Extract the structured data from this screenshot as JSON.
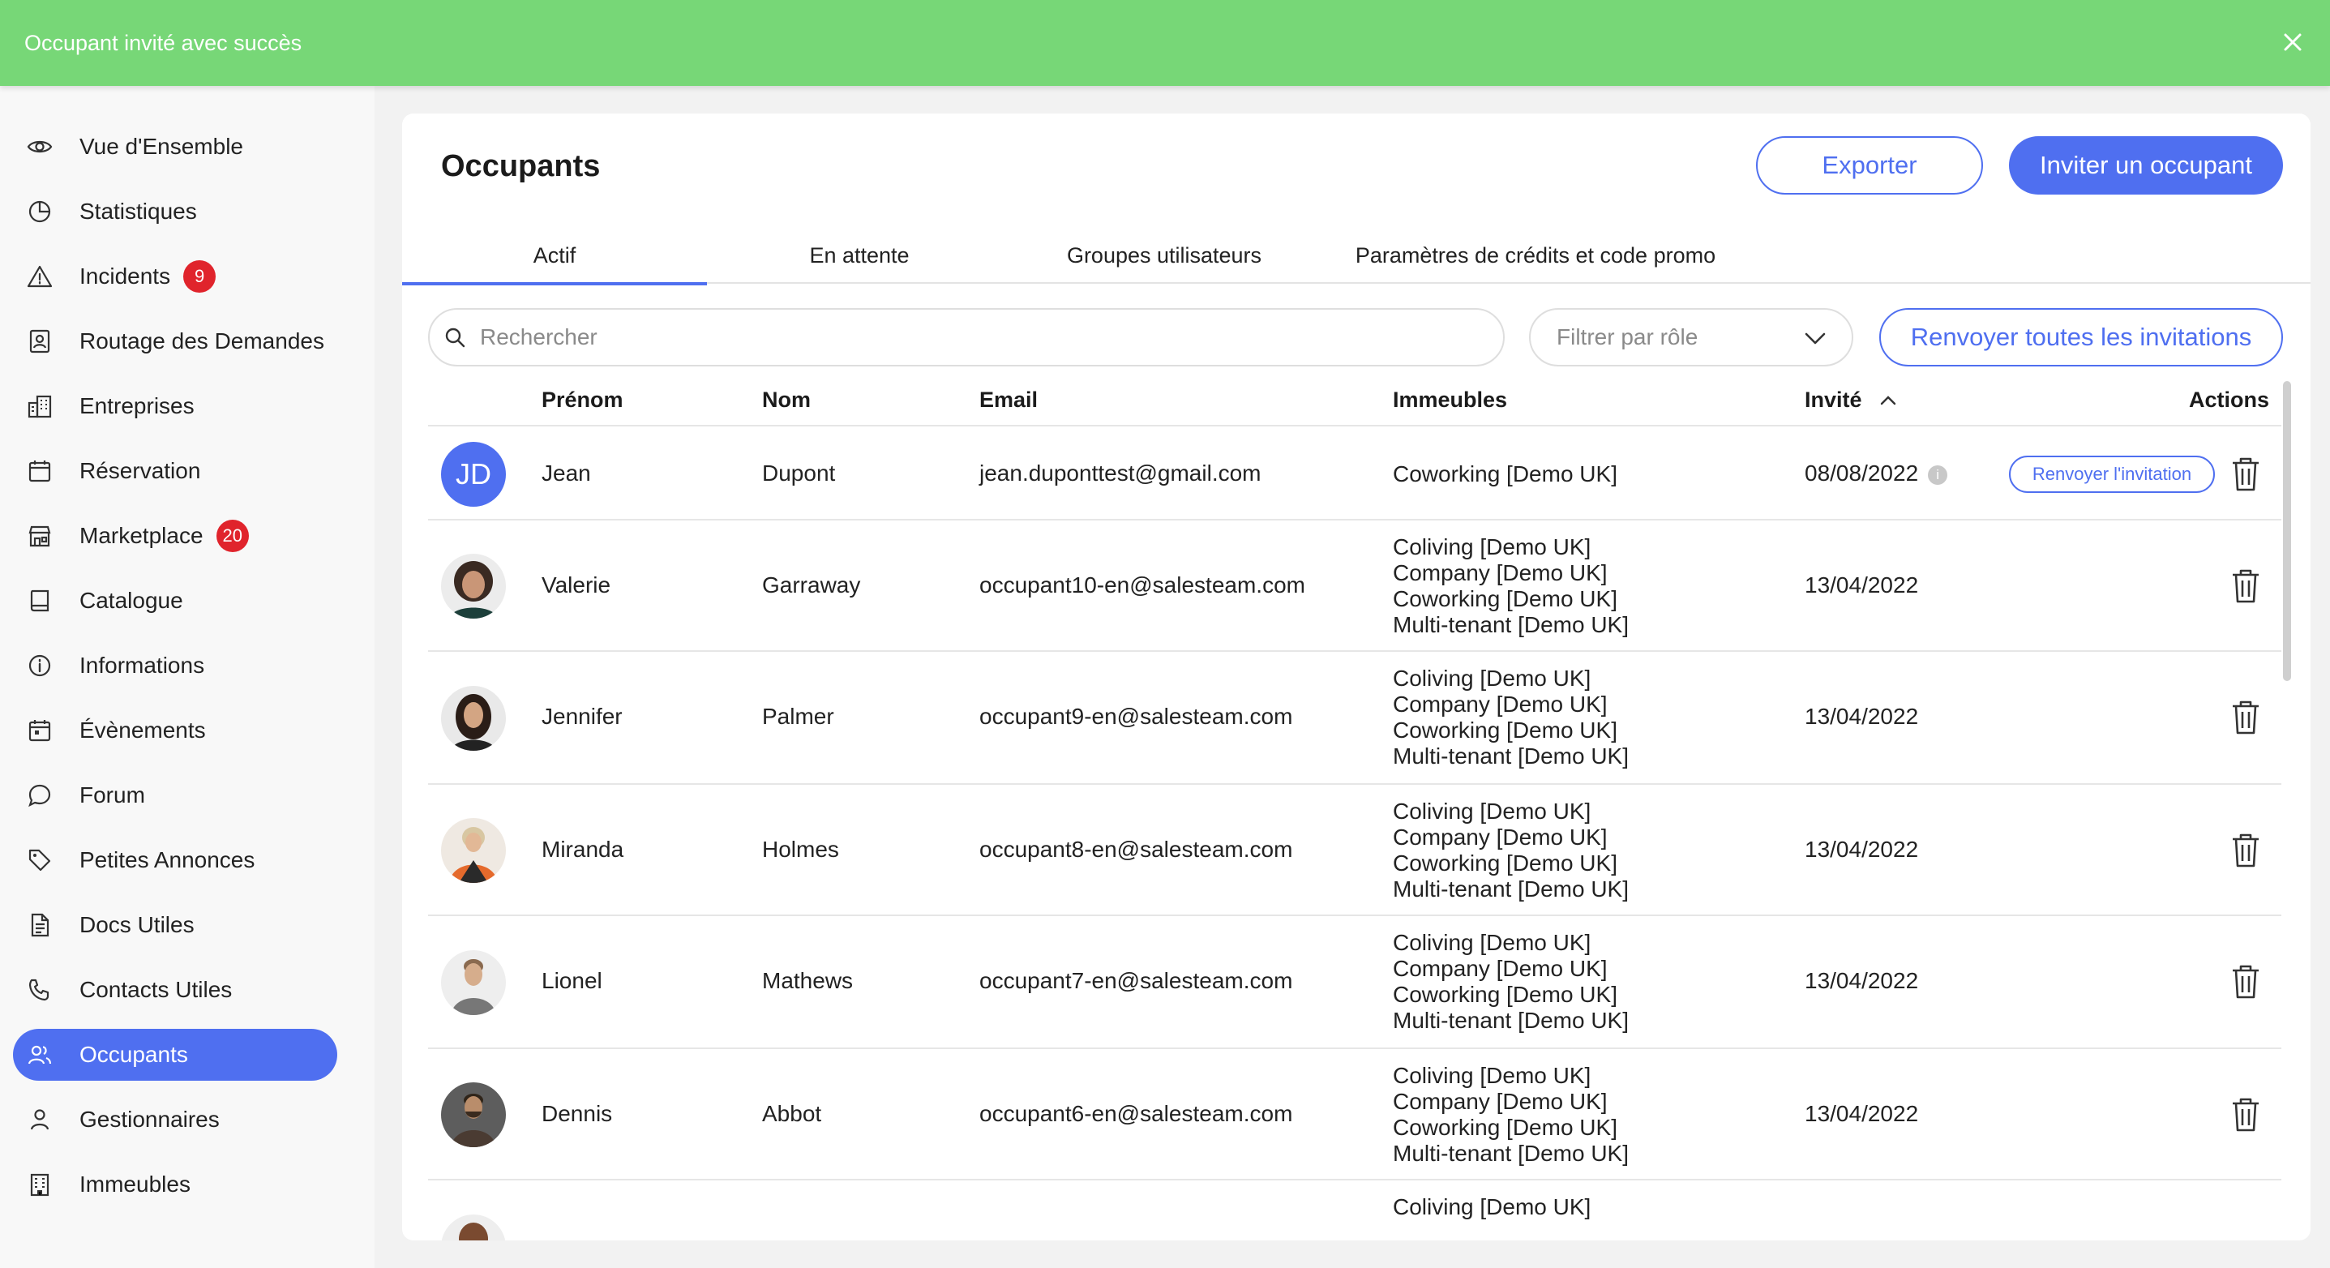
{
  "toast": {
    "message": "Occupant invité avec succès",
    "color": "#77d777"
  },
  "sidebar": {
    "items": [
      {
        "label": "Vue d'Ensemble",
        "icon": "eye-icon"
      },
      {
        "label": "Statistiques",
        "icon": "pie-chart-icon"
      },
      {
        "label": "Incidents",
        "icon": "warning-icon",
        "badge": "9"
      },
      {
        "label": "Routage des Demandes",
        "icon": "contact-card-icon"
      },
      {
        "label": "Entreprises",
        "icon": "buildings-icon"
      },
      {
        "label": "Réservation",
        "icon": "calendar-icon"
      },
      {
        "label": "Marketplace",
        "icon": "store-icon",
        "badge": "20"
      },
      {
        "label": "Catalogue",
        "icon": "book-icon"
      },
      {
        "label": "Informations",
        "icon": "info-icon"
      },
      {
        "label": "Évènements",
        "icon": "event-calendar-icon"
      },
      {
        "label": "Forum",
        "icon": "chat-bubble-icon"
      },
      {
        "label": "Petites Annonces",
        "icon": "tag-icon"
      },
      {
        "label": "Docs Utiles",
        "icon": "document-icon"
      },
      {
        "label": "Contacts Utiles",
        "icon": "phone-icon"
      },
      {
        "label": "Occupants",
        "icon": "users-icon",
        "active": true
      },
      {
        "label": "Gestionnaires",
        "icon": "user-icon"
      },
      {
        "label": "Immeubles",
        "icon": "building-icon"
      }
    ]
  },
  "main": {
    "title": "Occupants",
    "export_label": "Exporter",
    "invite_label": "Inviter un occupant",
    "tabs": [
      {
        "label": "Actif",
        "active": true
      },
      {
        "label": "En attente"
      },
      {
        "label": "Groupes utilisateurs"
      },
      {
        "label": "Paramètres de crédits et code promo"
      }
    ],
    "search": {
      "placeholder": "Rechercher"
    },
    "filter": {
      "placeholder": "Filtrer par rôle"
    },
    "resend_all_label": "Renvoyer toutes les invitations",
    "table": {
      "headers": {
        "first_name": "Prénom",
        "last_name": "Nom",
        "email": "Email",
        "buildings": "Immeubles",
        "invited": "Invité",
        "actions": "Actions"
      },
      "sort": "ascending",
      "rows": [
        {
          "initials": "JD",
          "first_name": "Jean",
          "last_name": "Dupont",
          "email": "jean.duponttest@gmail.com",
          "buildings": [
            "Coworking [Demo UK]"
          ],
          "invited": "08/08/2022",
          "resend_label": "Renvoyer l'invitation"
        },
        {
          "avatar": "woman-curly-hair",
          "first_name": "Valerie",
          "last_name": "Garraway",
          "email": "occupant10-en@salesteam.com",
          "buildings": [
            "Coliving [Demo UK]",
            "Company [Demo UK]",
            "Coworking [Demo UK]",
            "Multi-tenant [Demo UK]"
          ],
          "invited": "13/04/2022"
        },
        {
          "avatar": "woman-dark-hair",
          "first_name": "Jennifer",
          "last_name": "Palmer",
          "email": "occupant9-en@salesteam.com",
          "buildings": [
            "Coliving [Demo UK]",
            "Company [Demo UK]",
            "Coworking [Demo UK]",
            "Multi-tenant [Demo UK]"
          ],
          "invited": "13/04/2022"
        },
        {
          "avatar": "woman-blonde-orange-top",
          "first_name": "Miranda",
          "last_name": "Holmes",
          "email": "occupant8-en@salesteam.com",
          "buildings": [
            "Coliving [Demo UK]",
            "Company [Demo UK]",
            "Coworking [Demo UK]",
            "Multi-tenant [Demo UK]"
          ],
          "invited": "13/04/2022"
        },
        {
          "avatar": "man-grey-shirt",
          "first_name": "Lionel",
          "last_name": "Mathews",
          "email": "occupant7-en@salesteam.com",
          "buildings": [
            "Coliving [Demo UK]",
            "Company [Demo UK]",
            "Coworking [Demo UK]",
            "Multi-tenant [Demo UK]"
          ],
          "invited": "13/04/2022"
        },
        {
          "avatar": "man-beard-plaid",
          "first_name": "Dennis",
          "last_name": "Abbot",
          "email": "occupant6-en@salesteam.com",
          "buildings": [
            "Coliving [Demo UK]",
            "Company [Demo UK]",
            "Coworking [Demo UK]",
            "Multi-tenant [Demo UK]"
          ],
          "invited": "13/04/2022"
        },
        {
          "avatar": "partial",
          "first_name": "",
          "last_name": "",
          "email": "",
          "buildings": [
            "Coliving [Demo UK]"
          ],
          "invited": ""
        }
      ]
    }
  },
  "colors": {
    "accent": "#4f6ff0",
    "badge": "#e0242c",
    "success": "#77d777"
  }
}
